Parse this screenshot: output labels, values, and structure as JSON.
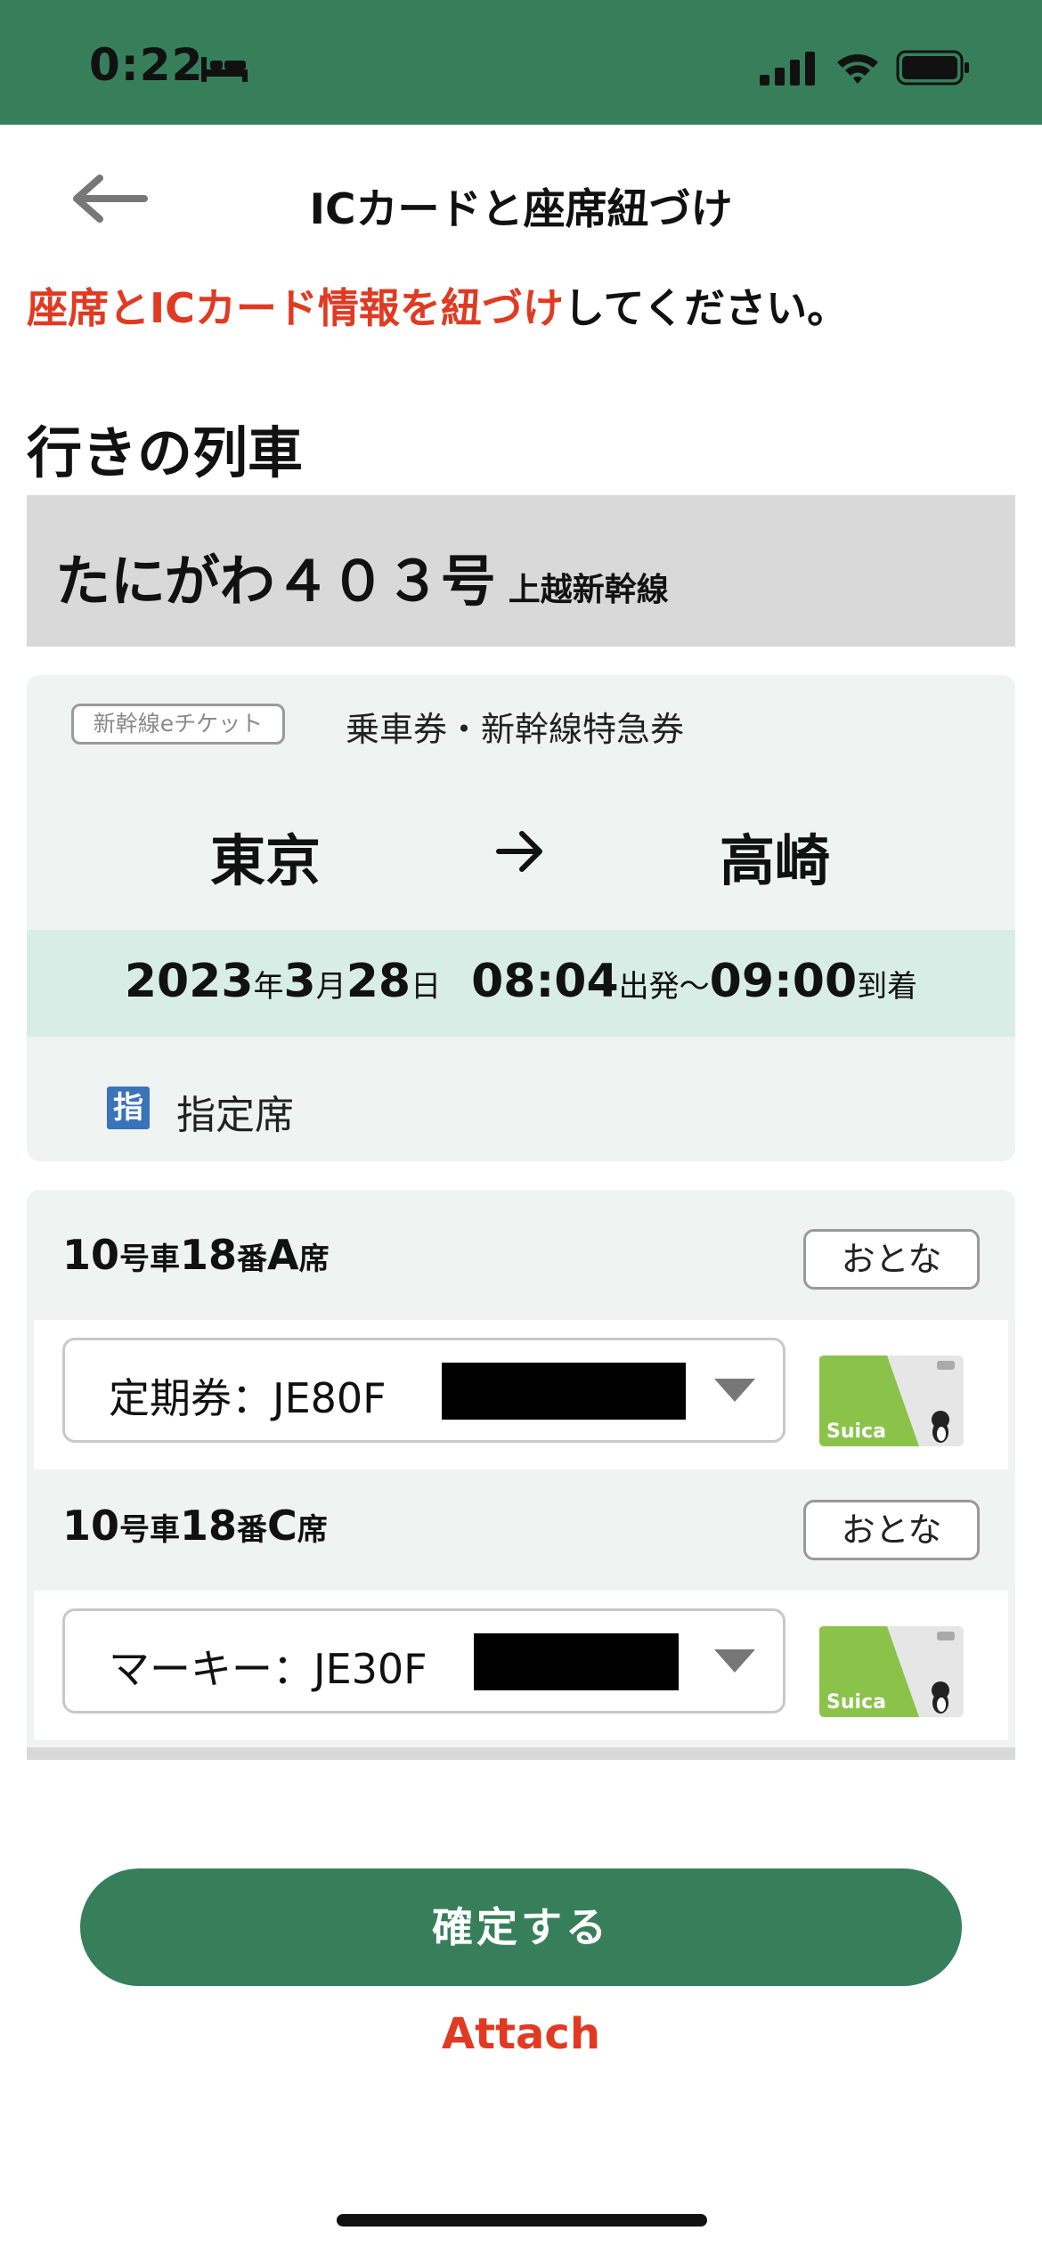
{
  "status_bar": {
    "time": "0:22"
  },
  "header": {
    "title": "ICカードと座席紐づけ"
  },
  "instruction": {
    "highlight": "座席とICカード情報を紐づけ",
    "rest": "してください。"
  },
  "section": {
    "title": "行きの列車"
  },
  "train": {
    "name": "たにがわ４０３号",
    "line": "上越新幹線"
  },
  "ticket": {
    "badge": "新幹線eチケット",
    "type": "乗車券・新幹線特急券",
    "from": "東京",
    "to": "高崎",
    "date": {
      "year": "2023",
      "year_unit": "年",
      "month": "3",
      "month_unit": "月",
      "day": "28",
      "day_unit": "日",
      "depart": "08:04",
      "depart_label": "出発～",
      "arrive": "09:00",
      "arrive_label": "到着"
    },
    "seat_class_icon_label": "指",
    "seat_class": "指定席"
  },
  "passengers": [
    {
      "car": "10",
      "car_unit": "号車",
      "seat_no": "18",
      "seat_unit": "番",
      "seat_letter": "A",
      "seat_suffix": "席",
      "fare_type": "おとな",
      "card_label": "定期券：JE80F"
    },
    {
      "car": "10",
      "car_unit": "号車",
      "seat_no": "18",
      "seat_unit": "番",
      "seat_letter": "C",
      "seat_suffix": "席",
      "fare_type": "おとな",
      "card_label": "マーキー：JE30F"
    }
  ],
  "actions": {
    "confirm_label": "確定する",
    "attach_label": "Attach"
  },
  "colors": {
    "brand_green": "#367f5a",
    "accent_red": "#e03a22"
  },
  "icons": [
    "bed-icon",
    "signal-icon",
    "wifi-icon",
    "battery-icon",
    "back-arrow-icon",
    "right-arrow-icon",
    "dropdown-icon",
    "suica-card-icon"
  ]
}
